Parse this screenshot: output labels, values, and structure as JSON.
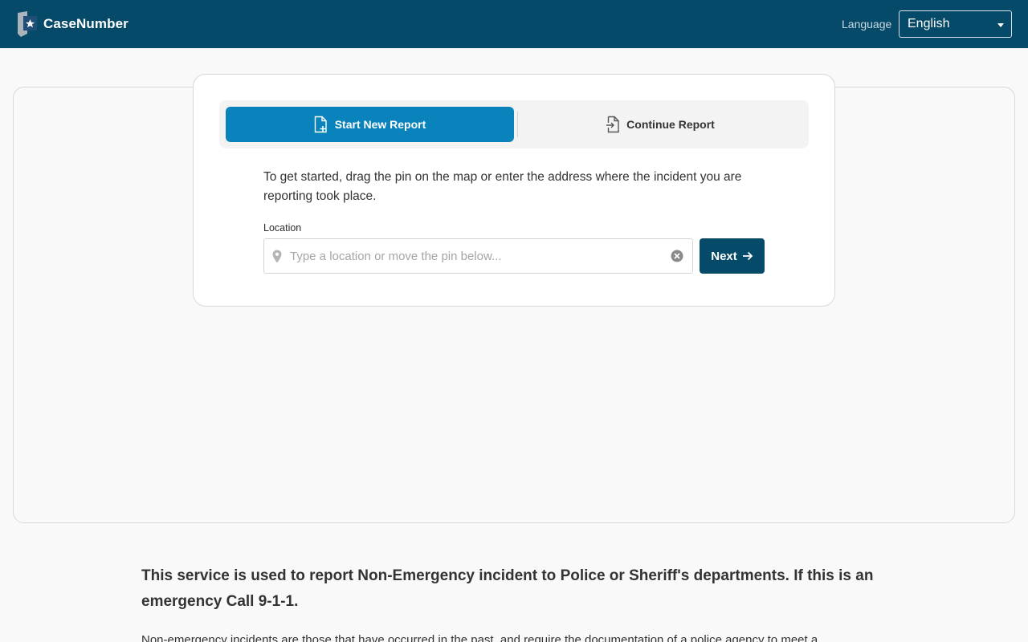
{
  "header": {
    "brand_name": "CaseNumber",
    "language_label": "Language",
    "language_selected": "English"
  },
  "tabs": {
    "start_new": "Start New Report",
    "continue": "Continue Report"
  },
  "form": {
    "intro": "To get started, drag the pin on the map or enter the address where the incident you are reporting took place.",
    "location_label": "Location",
    "location_placeholder": "Type a location or move the pin below...",
    "location_value": "",
    "next_label": "Next"
  },
  "info": {
    "heading": "This service is used to report Non-Emergency incident to Police or Sheriff's departments. If this is an emergency Call 9-1-1.",
    "body": "Non-emergency incidents are those that have occurred in the past, and require the documentation of a police agency to meet a"
  },
  "colors": {
    "header_bg": "#054a68",
    "active_tab": "#0a82bc",
    "primary_button": "#054a68"
  }
}
